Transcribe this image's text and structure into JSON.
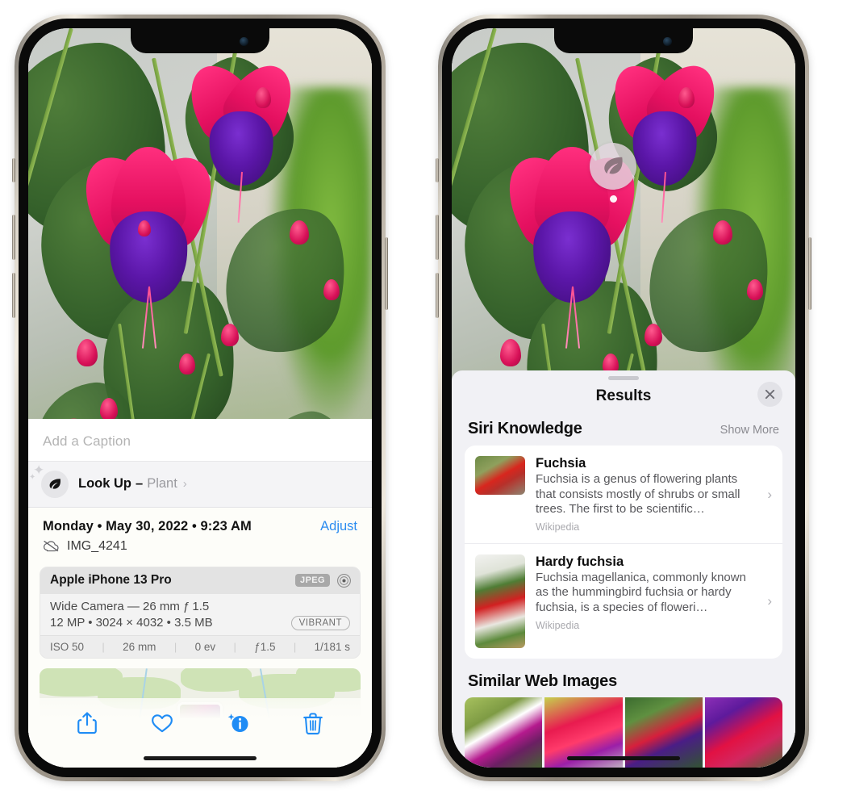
{
  "left_phone": {
    "name": "iPhone photo info view",
    "photo": {
      "alt_name": "fuchsia-flowers-photo"
    },
    "caption_field": {
      "placeholder": "Add a Caption",
      "value": ""
    },
    "lookup_row": {
      "icon": "leaf-icon",
      "sparkle_icon": "sparkles-icon",
      "label": "Look Up",
      "separator": "–",
      "value": "Plant",
      "chevron": "›"
    },
    "metadata": {
      "date_line": "Monday • May 30, 2022 • 9:23 AM",
      "adjust_label": "Adjust",
      "cloud_icon": "icloud-slash-icon",
      "filename": "IMG_4241"
    },
    "exif": {
      "device": "Apple iPhone 13 Pro",
      "format_badge": "JPEG",
      "aperture_icon": "aperture-icon",
      "lens": "Wide Camera — 26 mm ƒ 1.5",
      "size_line": "12 MP • 3024 × 4032 • 3.5 MB",
      "style_badge": "VIBRANT",
      "stats": [
        "ISO 50",
        "26 mm",
        "0 ev",
        "ƒ1.5",
        "1/181 s"
      ],
      "divider": "|"
    },
    "map": {
      "name": "location-map-thumbnail"
    },
    "toolbar": [
      {
        "name": "share-button",
        "icon": "share-icon"
      },
      {
        "name": "favorite-button",
        "icon": "heart-icon"
      },
      {
        "name": "info-button",
        "icon": "info-sparkle-icon"
      },
      {
        "name": "delete-button",
        "icon": "trash-icon"
      }
    ],
    "accent_color": "#2b8cf0"
  },
  "right_phone": {
    "name": "Visual Look Up results view",
    "siri_badge": {
      "icon": "leaf-icon",
      "name": "visual-lookup-badge"
    },
    "sheet": {
      "grabber": "drag-handle",
      "title": "Results",
      "close_icon": "close-icon"
    },
    "siri_knowledge": {
      "section_title": "Siri Knowledge",
      "show_more": "Show More",
      "items": [
        {
          "title": "Fuchsia",
          "description": "Fuchsia is a genus of flowering plants that consists mostly of shrubs or small trees. The first to be scientific…",
          "source": "Wikipedia",
          "chevron": "›",
          "thumb": "fuchsia-red-flowers-thumbnail"
        },
        {
          "title": "Hardy fuchsia",
          "description": "Fuchsia magellanica, commonly known as the hummingbird fuchsia or hardy fuchsia, is a species of floweri…",
          "source": "Wikipedia",
          "chevron": "›",
          "thumb": "hardy-fuchsia-specimen-thumbnail"
        }
      ]
    },
    "similar_web_images": {
      "section_title": "Similar Web Images",
      "items": [
        {
          "name": "web-image-1"
        },
        {
          "name": "web-image-2"
        },
        {
          "name": "web-image-3"
        },
        {
          "name": "web-image-4"
        }
      ]
    }
  }
}
